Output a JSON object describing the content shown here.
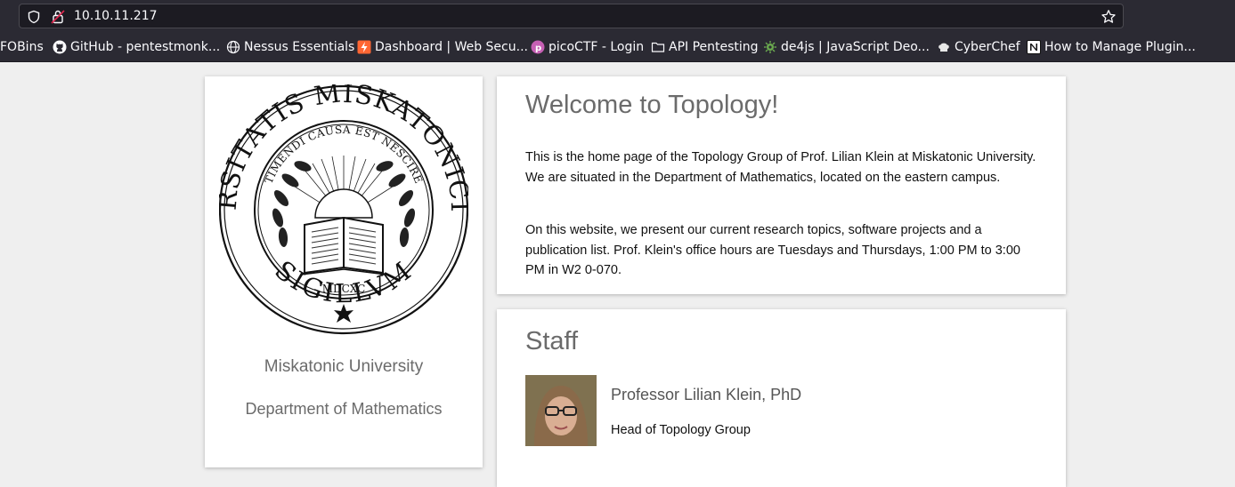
{
  "browser": {
    "url": "10.10.11.217",
    "bookmarks": [
      {
        "label": "FOBins",
        "icon": "none"
      },
      {
        "label": "GitHub - pentestmonk...",
        "icon": "github-icon"
      },
      {
        "label": "Nessus Essentials",
        "icon": "globe-icon"
      },
      {
        "label": "Dashboard | Web Secu...",
        "icon": "portswigger-icon"
      },
      {
        "label": "picoCTF - Login",
        "icon": "picoctf-icon"
      },
      {
        "label": "API Pentesting",
        "icon": "folder-icon"
      },
      {
        "label": "de4js | JavaScript Deo...",
        "icon": "de4js-icon"
      },
      {
        "label": "CyberChef",
        "icon": "chef-hat-icon"
      },
      {
        "label": "How to Manage Plugin...",
        "icon": "notion-icon"
      }
    ]
  },
  "sidebar": {
    "seal_top": "UNIVERSITATIS MISKATONICIENSIS",
    "seal_bottom": "SIGILLUM",
    "seal_motto": "TIMENDI CAUSA EST NESCIRE",
    "seal_year": "MDCXC",
    "university": "Miskatonic University",
    "department": "Department of Mathematics"
  },
  "welcome": {
    "title": "Welcome to Topology!",
    "paragraph1": "This is the home page of the Topology Group of Prof. Lilian Klein at Miskatonic University. We are situated in the Department of Mathematics, located on the eastern campus.",
    "paragraph2": "On this website, we present our current research topics, software projects and a publication list. Prof. Klein's office hours are Tuesdays and Thursdays, 1:00 PM to 3:00 PM in W2 0-070."
  },
  "staff": {
    "title": "Staff",
    "members": [
      {
        "name": "Professor Lilian Klein, PhD",
        "role": "Head of Topology Group"
      }
    ]
  }
}
